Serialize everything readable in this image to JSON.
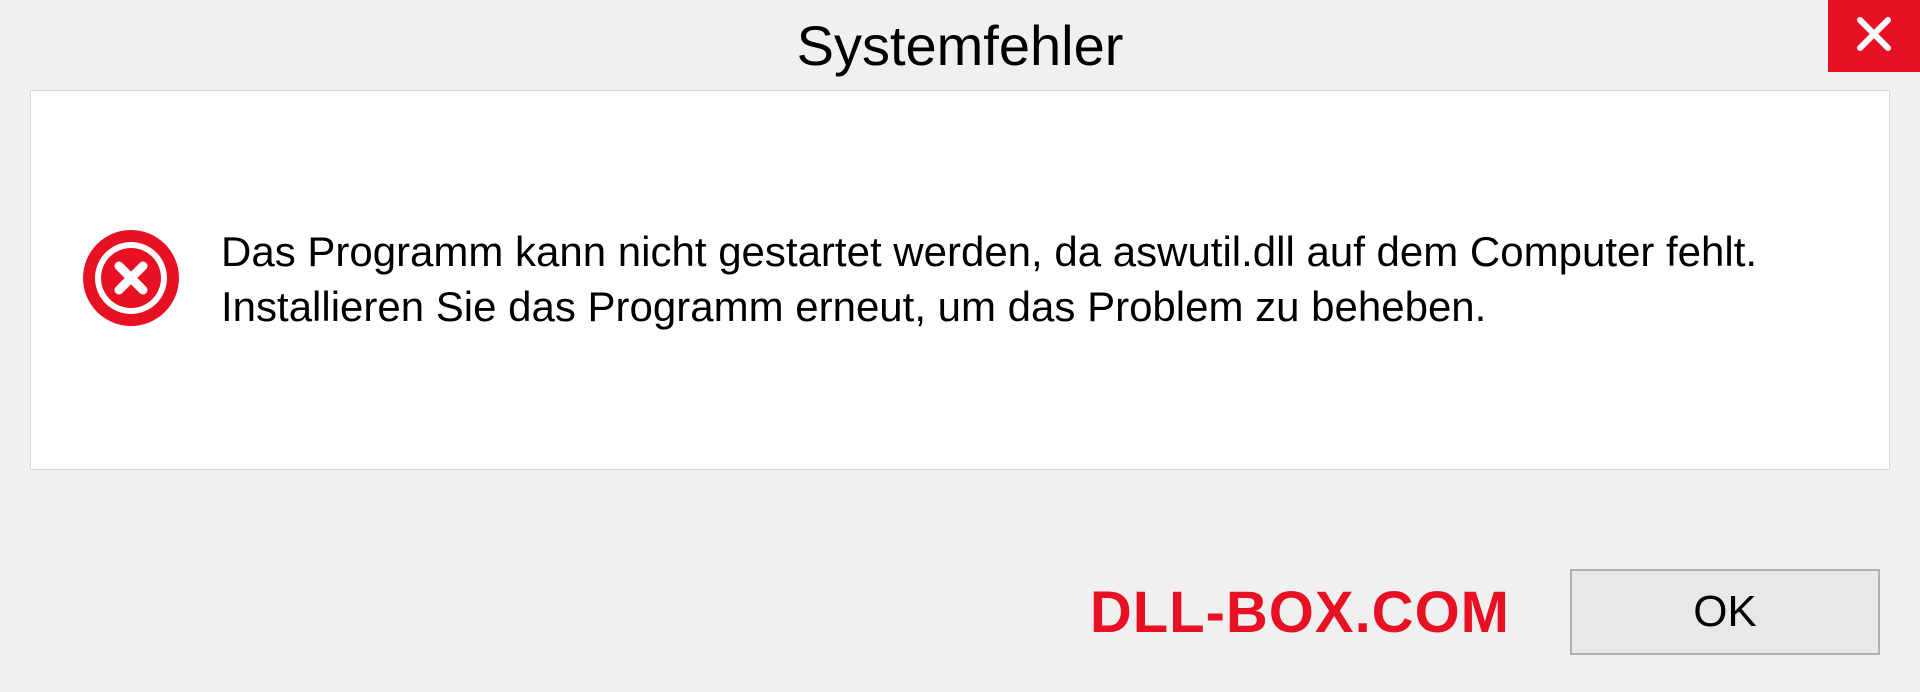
{
  "dialog": {
    "title": "Systemfehler",
    "message": "Das Programm kann nicht gestartet werden, da aswutil.dll auf dem Computer fehlt. Installieren Sie das Programm erneut, um das Problem zu beheben.",
    "ok_label": "OK"
  },
  "watermark": "DLL-BOX.COM",
  "icons": {
    "close": "close-icon",
    "error": "error-circle-x-icon"
  },
  "colors": {
    "accent_red": "#e81123",
    "background": "#f0f0f0",
    "panel": "#ffffff"
  }
}
